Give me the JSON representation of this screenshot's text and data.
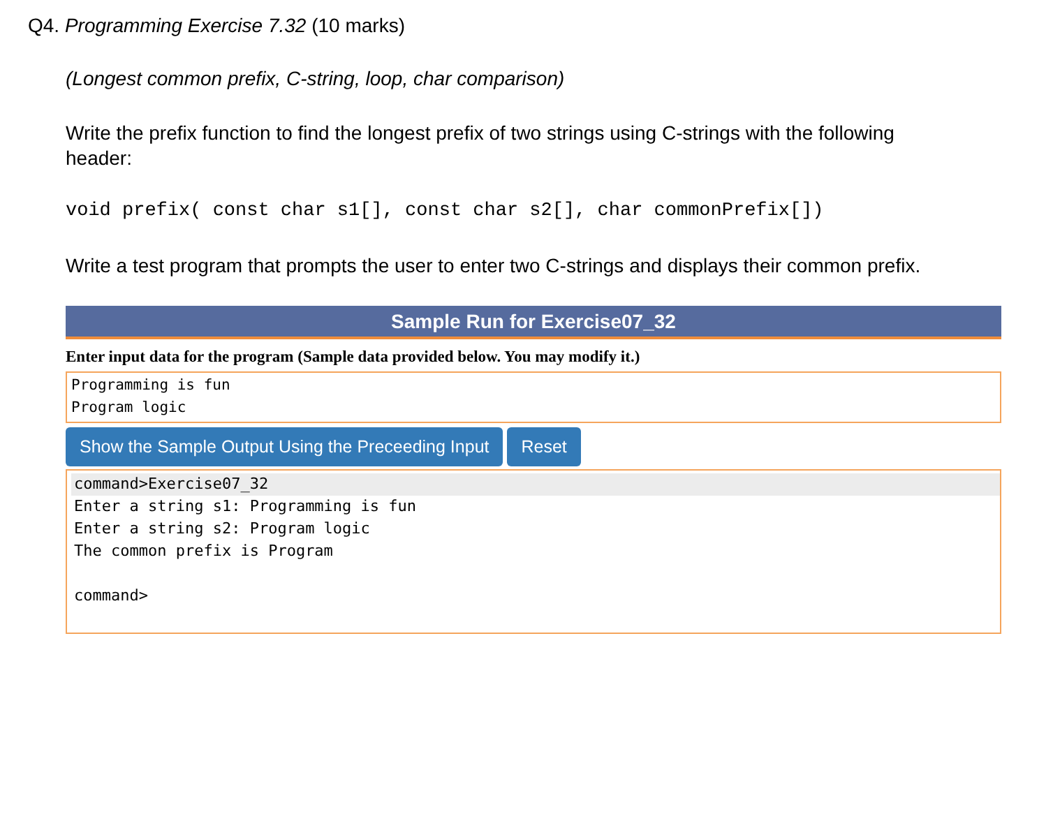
{
  "question": {
    "heading": "Q4. *Programming Exercise 7.32* (10 marks)",
    "topics": "(Longest common prefix, C-string, loop, char comparison)",
    "instruction": "Write the prefix function to find the longest prefix of two strings using C-strings with the following header:",
    "signature": "void prefix( const char s1[], const char s2[], char commonPrefix[])",
    "task": "Write a test program that prompts the user to enter two C-strings and displays their common prefix."
  },
  "sample_run": {
    "title": "Sample Run for Exercise07_32",
    "input_label": "Enter input data for the program (Sample data provided below. You may modify it.)",
    "input_value": "Programming is fun\nProgram logic",
    "buttons": [
      "Show the Sample Output Using the Preceeding Input",
      "Reset"
    ],
    "output_blocks": [
      [
        {
          "text": "command>Exercise07_32",
          "highlighted": true
        },
        {
          "text": "Enter a string s1: Programming is fun",
          "highlighted": false
        },
        {
          "text": "Enter a string s2: Program logic",
          "highlighted": false
        },
        {
          "text": "The common prefix is Program",
          "highlighted": false
        }
      ],
      [
        {
          "text": "command>",
          "highlighted": false
        }
      ]
    ]
  }
}
